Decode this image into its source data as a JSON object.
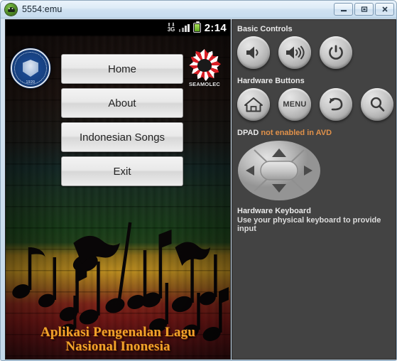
{
  "window": {
    "title": "5554:emu",
    "icon": "android-head-icon",
    "controls": [
      {
        "name": "minimize-button",
        "glyph": "minimize"
      },
      {
        "name": "maximize-button",
        "glyph": "maximize"
      },
      {
        "name": "close-button",
        "glyph": "close"
      }
    ]
  },
  "device": {
    "status_bar": {
      "network_arrows": "⬆⬇",
      "network_label": "3G",
      "signal_icon": "signal-bars-icon",
      "battery_icon": "battery-icon",
      "clock": "2:14"
    },
    "logos": {
      "left": {
        "name": "itb-seal-logo",
        "year": "1920",
        "alt": "Institut Teknologi Bandung"
      },
      "right": {
        "name": "seamolec-logo",
        "label": "SEAMOLEC"
      }
    },
    "menu_buttons": [
      {
        "label": "Home"
      },
      {
        "label": "About"
      },
      {
        "label": "Indonesian Songs"
      },
      {
        "label": "Exit"
      }
    ],
    "app_title_line1": "Aplikasi Pengenalan Lagu",
    "app_title_line2": "Nasional Inonesia",
    "title_color": "#f0a32a"
  },
  "panel": {
    "basic_controls_label": "Basic Controls",
    "basic_controls": [
      {
        "name": "volume-down-button",
        "icon": "speaker-low-icon"
      },
      {
        "name": "volume-up-button",
        "icon": "speaker-high-icon"
      },
      {
        "name": "power-button",
        "icon": "power-icon"
      }
    ],
    "hardware_buttons_label": "Hardware Buttons",
    "hardware_buttons": [
      {
        "name": "home-button",
        "icon": "home-icon",
        "label": ""
      },
      {
        "name": "menu-button",
        "icon": "menu-text-icon",
        "label": "MENU"
      },
      {
        "name": "back-button",
        "icon": "back-arrow-icon",
        "label": ""
      },
      {
        "name": "search-button",
        "icon": "search-icon",
        "label": ""
      }
    ],
    "dpad_label": "DPAD",
    "dpad_status": "not enabled in AVD",
    "dpad_status_color": "#e0914a",
    "keyboard_title": "Hardware Keyboard",
    "keyboard_sub": "Use your physical keyboard to provide input"
  }
}
